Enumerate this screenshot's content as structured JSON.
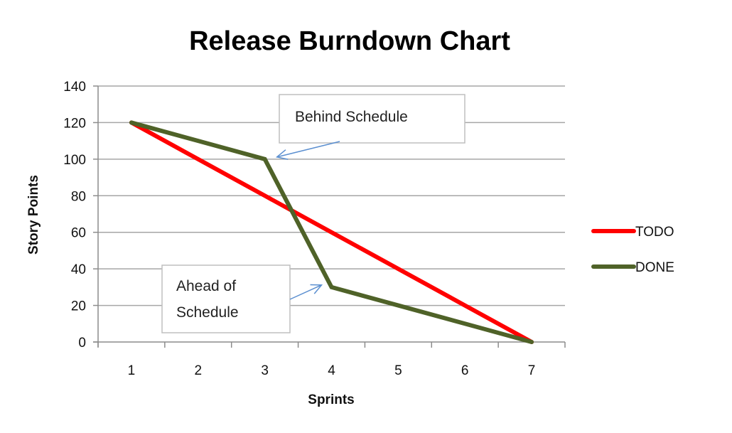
{
  "chart_data": {
    "type": "line",
    "title": "Release Burndown Chart",
    "xlabel": "Sprints",
    "ylabel": "Story Points",
    "categories": [
      "1",
      "2",
      "3",
      "4",
      "5",
      "6",
      "7"
    ],
    "ylim": [
      0,
      140
    ],
    "yticks": [
      "0",
      "20",
      "40",
      "60",
      "80",
      "100",
      "120",
      "140"
    ],
    "grid": true,
    "legend_position": "right",
    "series": [
      {
        "name": "TODO",
        "color": "#ff0000",
        "values": [
          120,
          100,
          80,
          60,
          40,
          20,
          0
        ]
      },
      {
        "name": "DONE",
        "color": "#4f6228",
        "values": [
          120,
          110,
          100,
          30,
          20,
          10,
          0
        ]
      }
    ],
    "annotations": [
      {
        "text": "Behind Schedule",
        "points_to": {
          "x": "3",
          "y": 100
        }
      },
      {
        "text_lines": [
          "Ahead of",
          "Schedule"
        ],
        "points_to": {
          "x": "4",
          "y": 30
        }
      }
    ],
    "arrow_color": "#5b8fd0"
  }
}
